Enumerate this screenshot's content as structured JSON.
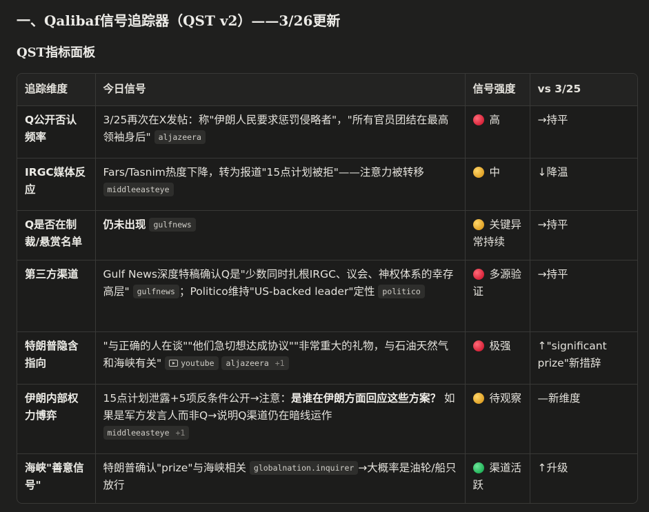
{
  "heading": "一、Qalibaf信号追踪器（QST v2）——3/26更新",
  "subheading": "QST指标面板",
  "table": {
    "headers": [
      "追踪维度",
      "今日信号",
      "信号强度",
      "vs 3/25"
    ],
    "rows": [
      {
        "dimension": "Q公开否认频率",
        "signal_text": "3/25再次在X发帖：称\"伊朗人民要求惩罚侵略者\"，\"所有官员团结在最高领袖身后\"",
        "sources": [
          "aljazeera"
        ],
        "strength_color": "red",
        "strength_label": "高",
        "vs_icon": "right-arrow",
        "vs": "→持平"
      },
      {
        "dimension": "IRGC媒体反应",
        "signal_text": "Fars/Tasnim热度下降，转为报道\"15点计划被拒\"——注意力被转移",
        "sources": [
          "middleeasteye"
        ],
        "strength_color": "yellow",
        "strength_label": "中",
        "vs_icon": "down-arrow",
        "vs": "↓降温"
      },
      {
        "dimension": "Q是否在制裁/悬赏名单",
        "signal_text": "仍未出现",
        "sources": [
          "gulfnews"
        ],
        "strength_color": "yellow",
        "strength_label": "关键异常持续",
        "vs_icon": "right-arrow",
        "vs": "→持平"
      },
      {
        "dimension": "第三方渠道",
        "signal_text_a": "Gulf News深度特稿确认Q是\"少数同时扎根IRGC、议会、神权体系的幸存高层\"",
        "source_a": "gulfnews",
        "signal_text_b": "；Politico维持\"US-backed leader\"定性",
        "source_b": "politico",
        "strength_color": "red",
        "strength_label": "多源验证",
        "vs_icon": "right-arrow",
        "vs": "→持平"
      },
      {
        "dimension": "特朗普隐含指向",
        "signal_text": "\"与正确的人在谈\"\"他们急切想达成协议\"\"非常重大的礼物，与石油天然气和海峡有关\"",
        "sources": [
          "youtube",
          "aljazeera"
        ],
        "sources_more": "+1",
        "strength_color": "red",
        "strength_label": "极强",
        "vs_icon": "up-arrow",
        "vs": "↑\"significant prize\"新措辞"
      },
      {
        "dimension": "伊朗内部权力博弈",
        "signal_text_a": "15点计划泄露+5项反条件公开→注意：",
        "signal_bold": "是谁在伊朗方面回应这些方案？",
        "signal_text_b": "如果是军方发言人而非Q→说明Q渠道仍在暗线运作",
        "sources": [
          "middleeasteye"
        ],
        "sources_more": "+1",
        "strength_color": "yellow",
        "strength_label": "待观察",
        "vs_icon": "dash",
        "vs": "—新维度"
      },
      {
        "dimension": "海峡\"善意信号\"",
        "signal_text_a": "特朗普确认\"prize\"与海峡相关",
        "source_a": "globalnation.inquirer",
        "signal_text_b": "→大概率是油轮/船只放行",
        "strength_color": "green",
        "strength_label": "渠道活跃",
        "vs_icon": "up-arrow",
        "vs": "↑升级"
      }
    ]
  }
}
